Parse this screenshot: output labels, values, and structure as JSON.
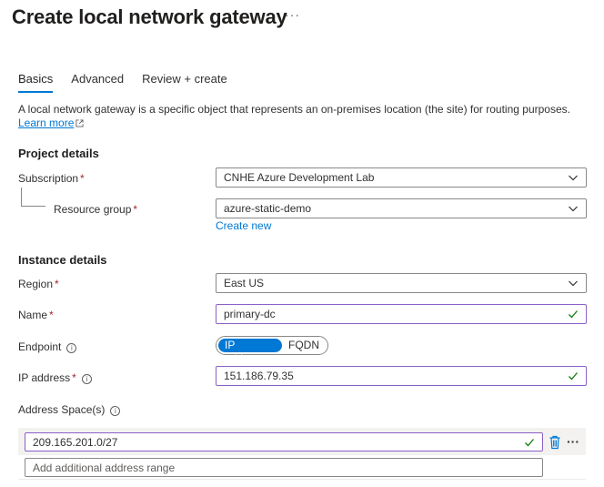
{
  "page": {
    "title": "Create local network gateway",
    "more": "···"
  },
  "tabs": [
    {
      "label": "Basics",
      "active": true
    },
    {
      "label": "Advanced",
      "active": false
    },
    {
      "label": "Review + create",
      "active": false
    }
  ],
  "description": {
    "text": "A local network gateway is a specific object that represents an on-premises location (the site) for routing purposes.",
    "link": "Learn more"
  },
  "project": {
    "heading": "Project details",
    "subscription_label": "Subscription",
    "subscription_value": "CNHE Azure Development Lab",
    "resource_group_label": "Resource group",
    "resource_group_value": "azure-static-demo",
    "create_new": "Create new"
  },
  "instance": {
    "heading": "Instance details",
    "region_label": "Region",
    "region_value": "East US",
    "name_label": "Name",
    "name_value": "primary-dc",
    "endpoint_label": "Endpoint",
    "endpoint_options": [
      "IP address",
      "FQDN"
    ],
    "endpoint_selected": "IP address",
    "ip_label": "IP address",
    "ip_value": "151.186.79.35",
    "address_space_label": "Address Space(s)",
    "address_ranges": [
      "209.165.201.0/27"
    ],
    "address_placeholder": "Add additional address range"
  },
  "colors": {
    "accent": "#0078d4",
    "required": "#a4262c",
    "valid": "#107c10",
    "valid_border": "#8a61c7"
  }
}
